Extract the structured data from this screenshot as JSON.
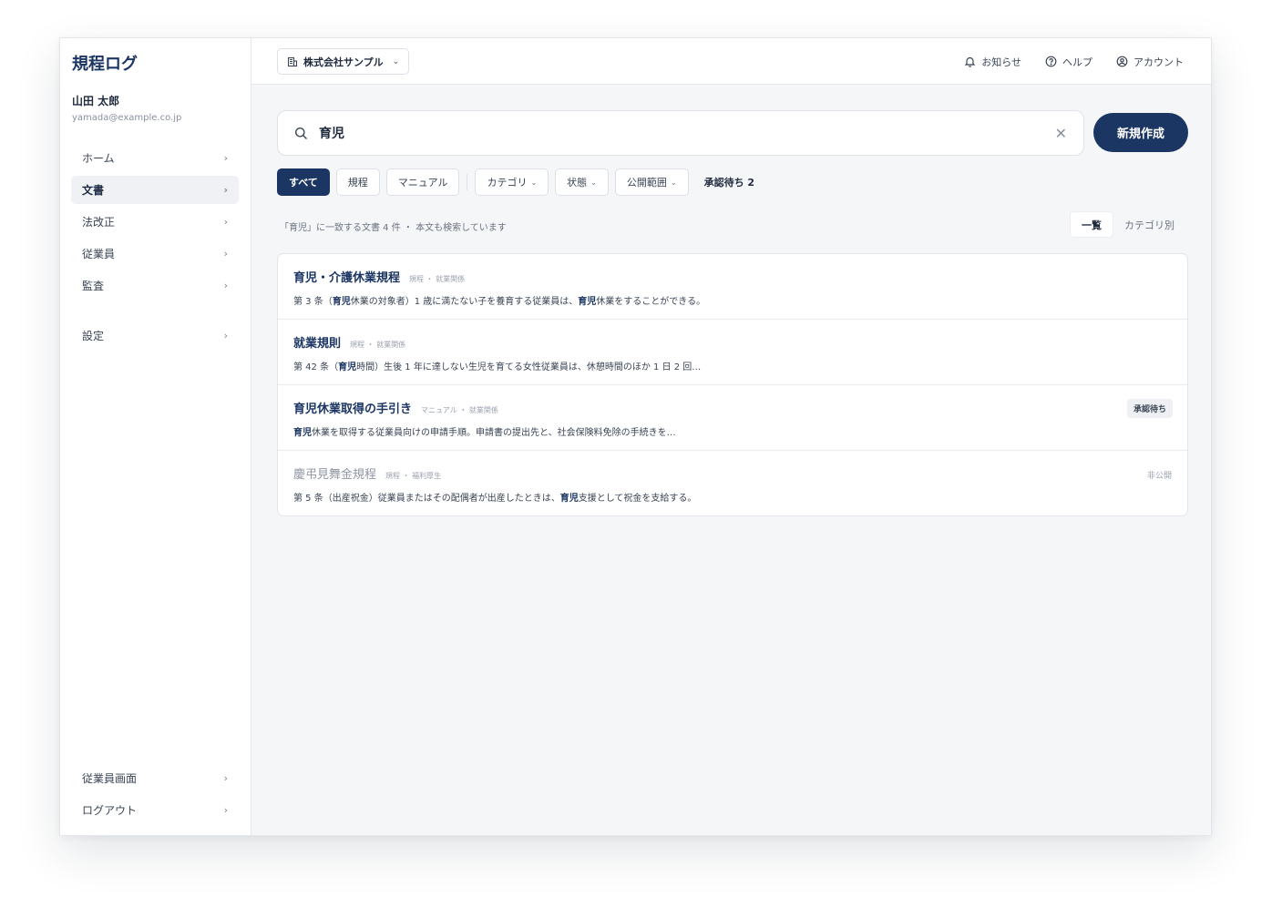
{
  "app": {
    "title": "規程ログ"
  },
  "user": {
    "name": "山田 太郎",
    "email": "yamada@example.co.jp"
  },
  "sidebar": {
    "items": [
      {
        "label": "ホーム",
        "active": false
      },
      {
        "label": "文書",
        "active": true
      },
      {
        "label": "法改正",
        "active": false
      },
      {
        "label": "従業員",
        "active": false
      },
      {
        "label": "監査",
        "active": false
      },
      {
        "label": "設定",
        "active": false
      }
    ],
    "bottom_items": [
      {
        "label": "従業員画面"
      },
      {
        "label": "ログアウト"
      }
    ]
  },
  "topbar": {
    "company": "株式会社サンプル",
    "notifications": "お知らせ",
    "help": "ヘルプ",
    "account": "アカウント"
  },
  "search": {
    "value": "育児",
    "new_button": "新規作成"
  },
  "filters": {
    "all": "すべて",
    "rules": "規程",
    "manual": "マニュアル",
    "category": "カテゴリ",
    "status": "状態",
    "scope": "公開範囲",
    "pending": "承認待ち 2"
  },
  "results_summary": "「育児」に一致する文書 4 件 ・ 本文も検索しています",
  "view": {
    "list": "一覧",
    "by_category": "カテゴリ別"
  },
  "results": [
    {
      "title": "育児・介護休業規程",
      "meta": "規程 ・ 就業関係",
      "snippet_parts": [
        "第 3 条（",
        "育児",
        "休業の対象者）1 歳に満たない子を養育する従業員は、",
        "育児",
        "休業をすることができる。"
      ],
      "badge": "",
      "status": ""
    },
    {
      "title": "就業規則",
      "meta": "規程 ・ 就業関係",
      "snippet_parts": [
        "第 42 条（",
        "育児",
        "時間）生後 1 年に達しない生児を育てる女性従業員は、休憩時間のほか 1 日 2 回…",
        "",
        ""
      ],
      "badge": "",
      "status": ""
    },
    {
      "title": "育児休業取得の手引き",
      "meta": "マニュアル ・ 就業関係",
      "snippet_parts": [
        "",
        "育児",
        "休業を取得する従業員向けの申請手順。申請書の提出先と、社会保険料免除の手続きを…",
        "",
        ""
      ],
      "badge": "承認待ち",
      "status": ""
    },
    {
      "title": "慶弔見舞金規程",
      "meta": "規程 ・ 福利厚生",
      "snippet_parts": [
        "第 5 条（出産祝金）従業員またはその配偶者が出産したときは、",
        "育児",
        "支援として祝金を支給する。",
        "",
        ""
      ],
      "badge": "",
      "status": "非公開"
    }
  ],
  "colors": {
    "primary": "#1c3664",
    "background": "#f5f6f8"
  }
}
